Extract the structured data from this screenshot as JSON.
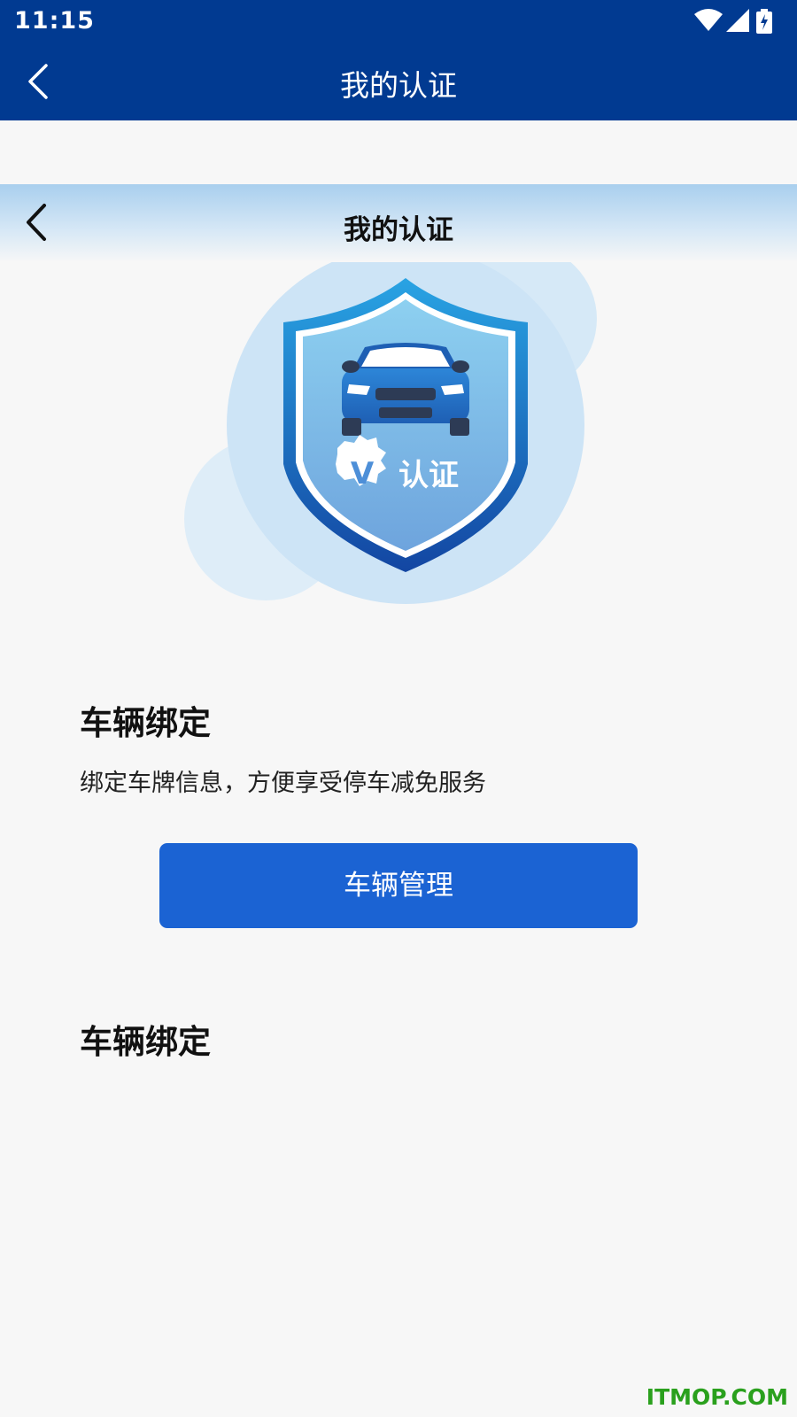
{
  "status_bar": {
    "time": "11:15"
  },
  "app_bar": {
    "title": "我的认证"
  },
  "web_header": {
    "title": "我的认证"
  },
  "hero": {
    "badge_text": "认证",
    "badge_letter": "V"
  },
  "section1": {
    "title": "车辆绑定",
    "description": "绑定车牌信息，方便享受停车减免服务",
    "button_label": "车辆管理"
  },
  "section2": {
    "title": "车辆绑定"
  },
  "watermark": "ITMOP.COM",
  "colors": {
    "app_bar": "#013a91",
    "primary_button": "#1b63d3",
    "background": "#f7f7f7"
  }
}
